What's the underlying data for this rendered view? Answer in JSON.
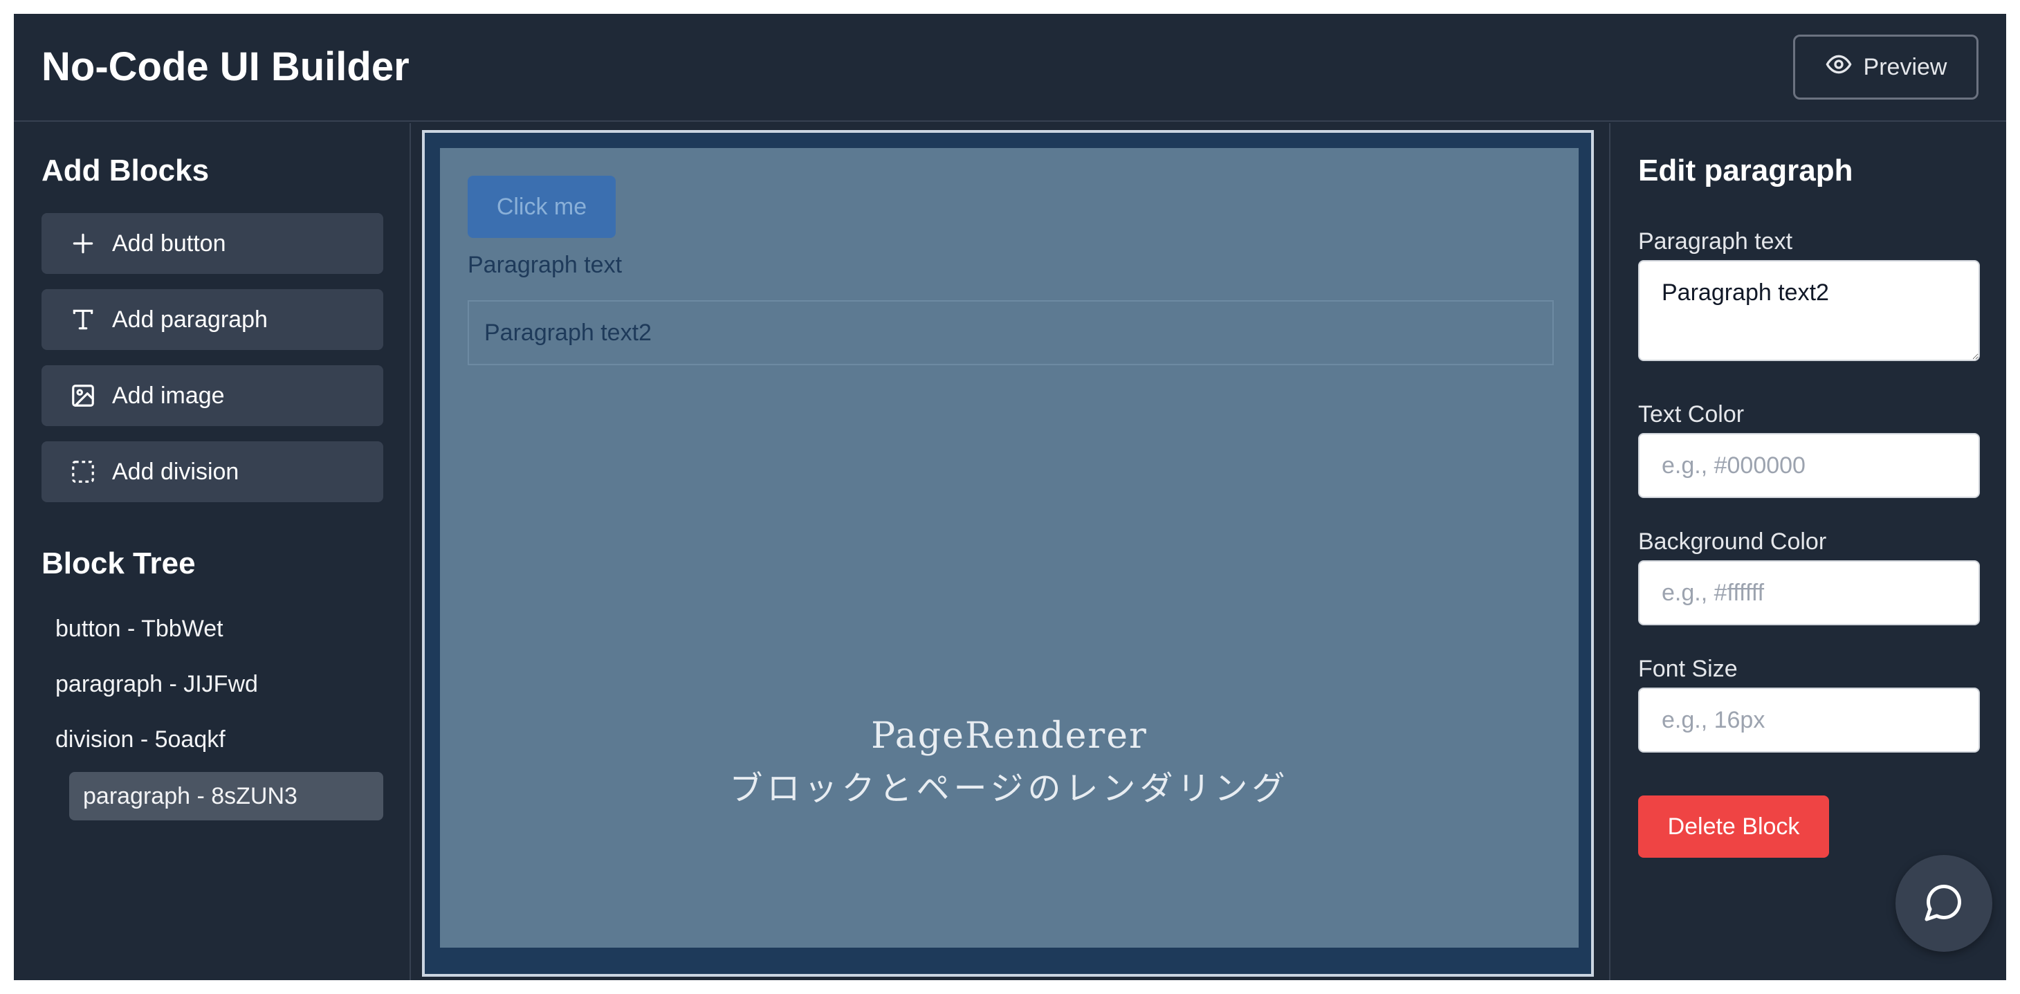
{
  "header": {
    "title": "No-Code UI Builder",
    "preview_label": "Preview",
    "preview_icon": "eye-icon"
  },
  "sidebar_left": {
    "add_blocks_title": "Add Blocks",
    "add_buttons": [
      {
        "label": "Add button",
        "icon": "plus-icon"
      },
      {
        "label": "Add paragraph",
        "icon": "text-icon"
      },
      {
        "label": "Add image",
        "icon": "image-icon"
      },
      {
        "label": "Add division",
        "icon": "dashed-square-icon"
      }
    ],
    "block_tree_title": "Block Tree",
    "tree_items": [
      {
        "label": "button - TbbWet",
        "selected": false
      },
      {
        "label": "paragraph - JIJFwd",
        "selected": false
      },
      {
        "label": "division - 5oaqkf",
        "selected": false
      },
      {
        "label": "paragraph - 8sZUN3",
        "selected": true
      }
    ]
  },
  "canvas": {
    "button_label": "Click me",
    "paragraph_text": "Paragraph text",
    "division_paragraph_text": "Paragraph text2",
    "overlay_title": "PageRenderer",
    "overlay_subtitle": "ブロックとページのレンダリング"
  },
  "sidebar_right": {
    "title": "Edit paragraph",
    "paragraph_text_label": "Paragraph text",
    "paragraph_text_value": "Paragraph text2",
    "text_color_label": "Text Color",
    "text_color_placeholder": "e.g., #000000",
    "background_color_label": "Background Color",
    "background_color_placeholder": "e.g., #ffffff",
    "font_size_label": "Font Size",
    "font_size_placeholder": "e.g., 16px",
    "delete_label": "Delete Block"
  },
  "chat_fab_icon": "chat-bubble-icon",
  "colors": {
    "app_background": "#1f2937",
    "panel_button": "#374151",
    "delete": "#ef4444",
    "canvas_button": "#3b6fb0",
    "canvas_surface": "#5d7a92"
  }
}
